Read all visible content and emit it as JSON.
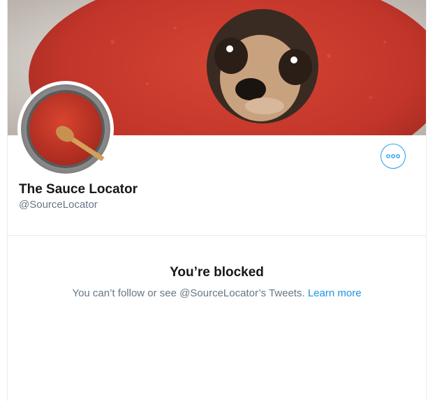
{
  "profile": {
    "display_name": "The Sauce Locator",
    "handle": "@SourceLocator",
    "banner_image": "dog-in-tomato-sauce",
    "avatar_image": "pot-of-tomato-sauce-with-wooden-spoon"
  },
  "actions": {
    "more_icon": "more-dots-icon"
  },
  "blocked_notice": {
    "title": "You’re blocked",
    "message": "You can’t follow or see @SourceLocator’s Tweets.",
    "link_label": "Learn more"
  },
  "colors": {
    "accent": "#1da1f2",
    "link": "#1b95e0",
    "primary_text": "#14171a",
    "secondary_text": "#657786",
    "border": "#e6ecf0",
    "sauce": "#c5362a"
  }
}
